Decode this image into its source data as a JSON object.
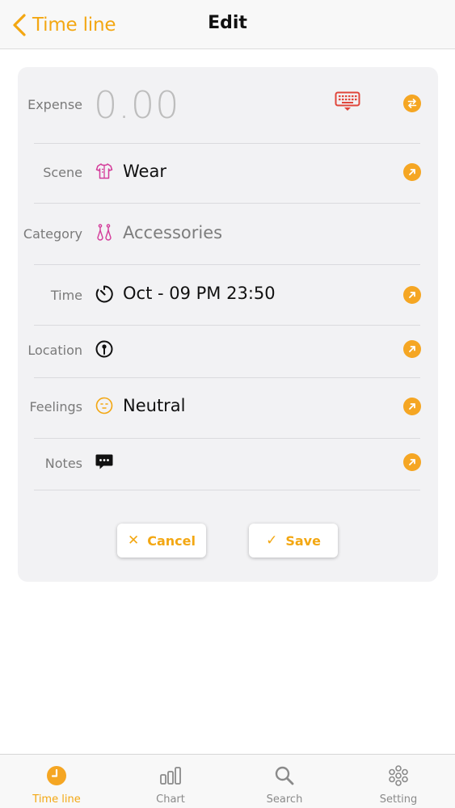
{
  "nav": {
    "back_label": "Time line",
    "title": "Edit"
  },
  "expense": {
    "label": "Expense",
    "amount": "0.00"
  },
  "scene": {
    "label": "Scene",
    "value": "Wear"
  },
  "category": {
    "label": "Category",
    "value": "Accessories"
  },
  "time": {
    "label": "Time",
    "value": "Oct  - 09  PM 23:50"
  },
  "location": {
    "label": "Location",
    "value": ""
  },
  "feelings": {
    "label": "Feelings",
    "value": "Neutral"
  },
  "notes": {
    "label": "Notes",
    "value": ""
  },
  "buttons": {
    "cancel": "Cancel",
    "save": "Save"
  },
  "tabs": [
    {
      "label": "Time line",
      "icon": "clock-icon",
      "active": true
    },
    {
      "label": "Chart",
      "icon": "bar-chart-icon",
      "active": false
    },
    {
      "label": "Search",
      "icon": "search-icon",
      "active": false
    },
    {
      "label": "Setting",
      "icon": "settings-icon",
      "active": false
    }
  ],
  "colors": {
    "accent": "#f3a712",
    "keyboard_red": "#e0453a",
    "scene_pink": "#d43c9a"
  }
}
